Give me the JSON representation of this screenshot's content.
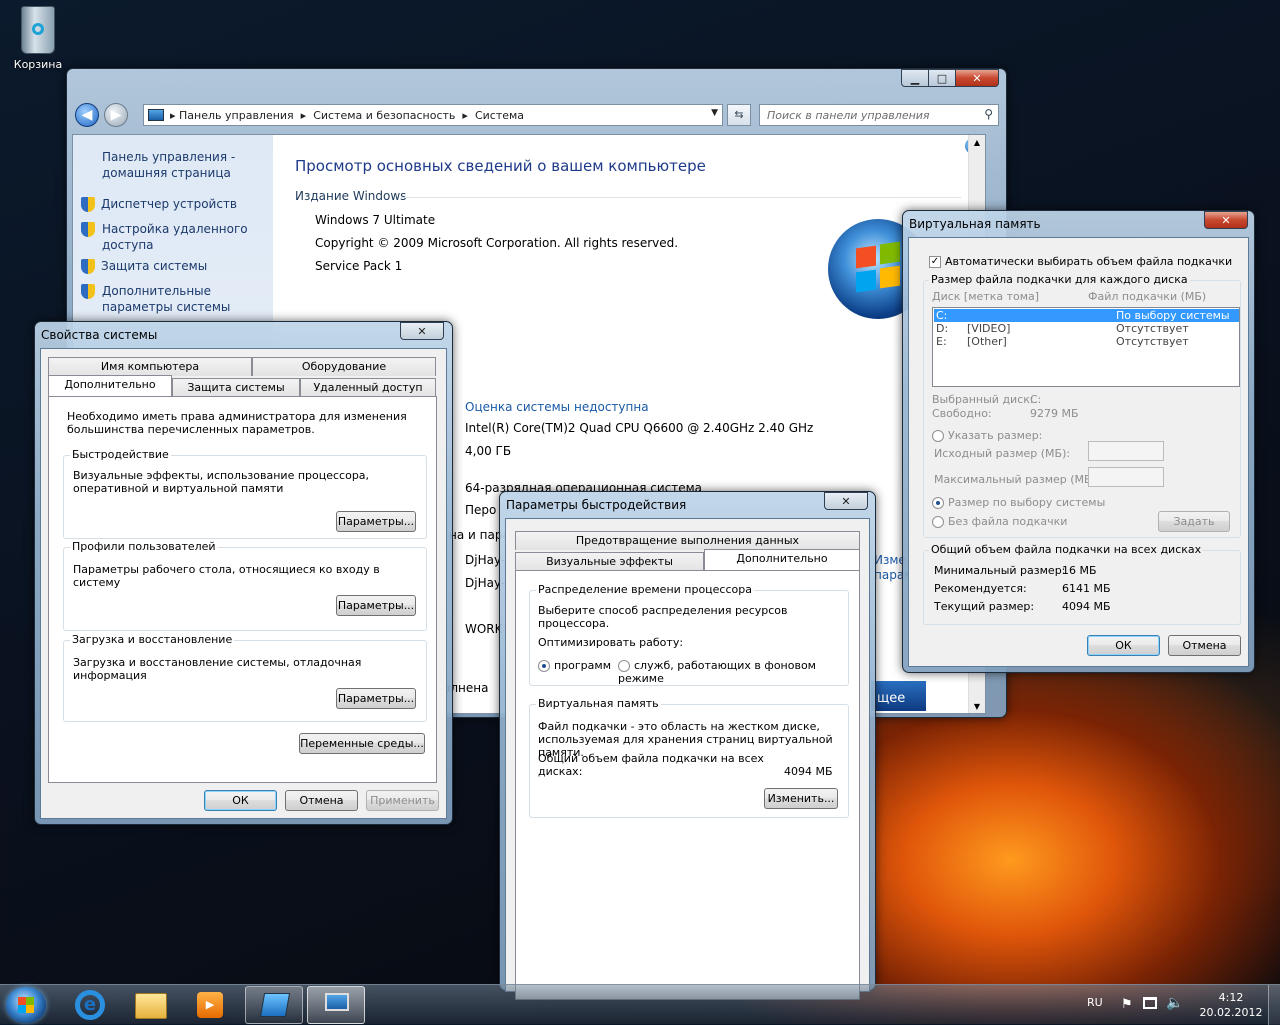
{
  "desktop": {
    "recycle_label": "Корзина"
  },
  "cp": {
    "breadcrumb": [
      "Панель управления",
      "Система и безопасность",
      "Система"
    ],
    "search_placeholder": "Поиск в панели управления",
    "sidebar": {
      "home": "Панель управления - домашняя страница",
      "items": [
        "Диспетчер устройств",
        "Настройка удаленного доступа",
        "Защита системы",
        "Дополнительные параметры системы"
      ]
    },
    "title": "Просмотр основных сведений о вашем компьютере",
    "edition_header": "Издание Windows",
    "edition": "Windows 7 Ultimate",
    "copyright": "Copyright © 2009 Microsoft Corporation.  All rights reserved.",
    "sp": "Service Pack 1",
    "rating": "Оценка системы недоступна",
    "cpu": "Intel(R) Core(TM)2 Quad CPU    Q6600  @ 2.40GHz   2.40 GHz",
    "ram": "4,00 ГБ",
    "os_type": "64-разрядная операционная система",
    "pen": "Перо",
    "name_frag": "на и пара",
    "host1": "DjHay-",
    "host2": "DjHay-",
    "wg": "WORK",
    "act": "олнена",
    "change": "Изме",
    "param": "параме",
    "more": "щее"
  },
  "sysprops": {
    "title": "Свойства системы",
    "tabs_top": [
      "Имя компьютера",
      "Оборудование"
    ],
    "tabs_bottom": [
      "Дополнительно",
      "Защита системы",
      "Удаленный доступ"
    ],
    "notice": "Необходимо иметь права администратора для изменения большинства перечисленных параметров.",
    "perf_title": "Быстродействие",
    "perf_text": "Визуальные эффекты, использование процессора, оперативной и виртуальной памяти",
    "prof_title": "Профили пользователей",
    "prof_text": "Параметры рабочего стола, относящиеся ко входу в систему",
    "boot_title": "Загрузка и восстановление",
    "boot_text": "Загрузка и восстановление системы, отладочная информация",
    "params": "Параметры...",
    "env": "Переменные среды...",
    "ok": "ОК",
    "cancel": "Отмена",
    "apply": "Применить"
  },
  "perf": {
    "title": "Параметры быстродействия",
    "tab_top": "Предотвращение выполнения данных",
    "tabs_bottom": [
      "Визуальные эффекты",
      "Дополнительно"
    ],
    "cpu_title": "Распределение времени процессора",
    "cpu_text": "Выберите способ распределения ресурсов процессора.",
    "optimize": "Оптимизировать работу:",
    "r1": "программ",
    "r2": "служб, работающих в фоновом режиме",
    "vm_title": "Виртуальная память",
    "vm_text1": "Файл подкачки - это область на жестком диске,",
    "vm_text2": "используемая для хранения страниц виртуальной памяти.",
    "total_label1": "Общий объем файла подкачки на всех",
    "total_label2": "дисках:",
    "total_value": "4094 МБ",
    "change": "Изменить..."
  },
  "vm": {
    "title": "Виртуальная память",
    "auto": "Автоматически выбирать объем файла подкачки",
    "group1": "Размер файла подкачки для каждого диска",
    "col1": "Диск [метка тома]",
    "col2": "Файл подкачки (МБ)",
    "rows": [
      {
        "d": "C:",
        "l": "",
        "v": "По выбору системы"
      },
      {
        "d": "D:",
        "l": "[VIDEO]",
        "v": "Отсутствует"
      },
      {
        "d": "E:",
        "l": "[Other]",
        "v": "Отсутствует"
      }
    ],
    "sel_label": "Выбранный диск:",
    "sel_val": "C:",
    "free_label": "Свободно:",
    "free_val": "9279 МБ",
    "custom": "Указать размер:",
    "init": "Исходный размер (МБ):",
    "max": "Максимальный размер (МБ):",
    "system": "Размер по выбору системы",
    "nofile": "Без файла подкачки",
    "set": "Задать",
    "group2": "Общий объем файла подкачки на всех дисках",
    "min_l": "Минимальный размер:",
    "min_v": "16 МБ",
    "rec_l": "Рекомендуется:",
    "rec_v": "6141 МБ",
    "cur_l": "Текущий размер:",
    "cur_v": "4094 МБ",
    "ok": "ОК",
    "cancel": "Отмена"
  },
  "taskbar": {
    "lang": "RU",
    "time": "4:12",
    "date": "20.02.2012"
  }
}
